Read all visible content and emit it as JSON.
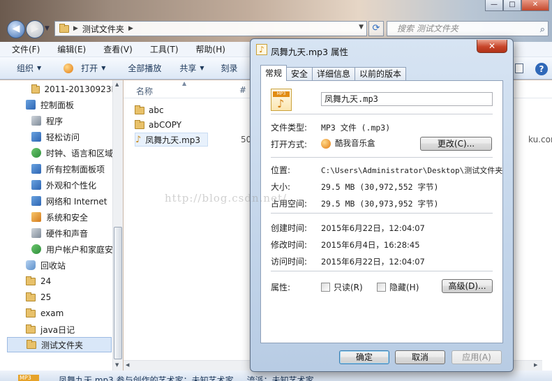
{
  "explorer": {
    "window_controls": {
      "minimize": "—",
      "maximize": "□",
      "close": "✕"
    },
    "address": {
      "crumbs": [
        "测试文件夹"
      ]
    },
    "search": {
      "placeholder": "搜索 测试文件夹"
    },
    "menu": [
      "文件(F)",
      "编辑(E)",
      "查看(V)",
      "工具(T)",
      "帮助(H)"
    ],
    "toolbar": [
      "组织",
      "打开",
      "全部播放",
      "共享",
      "刻录"
    ],
    "nav": [
      {
        "label": "2011-20130923I",
        "icon": "folder-icon"
      },
      {
        "label": "控制面板",
        "icon": "control-panel-icon"
      },
      {
        "label": "程序",
        "icon": "programs-icon"
      },
      {
        "label": "轻松访问",
        "icon": "ease-of-access-icon"
      },
      {
        "label": "时钟、语言和区域",
        "icon": "clock-language-icon"
      },
      {
        "label": "所有控制面板项",
        "icon": "all-items-icon"
      },
      {
        "label": "外观和个性化",
        "icon": "appearance-icon"
      },
      {
        "label": "网络和 Internet",
        "icon": "network-icon"
      },
      {
        "label": "系统和安全",
        "icon": "security-icon"
      },
      {
        "label": "硬件和声音",
        "icon": "hardware-sound-icon"
      },
      {
        "label": "用户帐户和家庭安全",
        "icon": "user-accounts-icon"
      },
      {
        "label": "回收站",
        "icon": "recycle-bin-icon"
      },
      {
        "label": "24",
        "icon": "folder-icon"
      },
      {
        "label": "25",
        "icon": "folder-icon"
      },
      {
        "label": "exam",
        "icon": "folder-icon"
      },
      {
        "label": "java日记",
        "icon": "folder-icon"
      },
      {
        "label": "测试文件夹",
        "icon": "folder-icon"
      }
    ],
    "columns": {
      "name": "名称",
      "next": "#"
    },
    "files": [
      {
        "name": "abc",
        "icon": "folder-icon"
      },
      {
        "name": "abCOPY",
        "icon": "folder-icon"
      },
      {
        "name": "凤舞九天.mp3",
        "icon": "music-file-icon"
      }
    ],
    "file_size_partial": "50",
    "bg_text_right": "ku.com",
    "status": {
      "filename": "凤舞九天.mp3",
      "text": "凤舞九天.mp3  参与创作的艺术家：未知艺术家  ...   流派：未知艺术家"
    },
    "watermark": "http://blog.csdn.net/"
  },
  "dialog": {
    "title": "凤舞九天.mp3 属性",
    "close": "✕",
    "tabs": [
      "常规",
      "安全",
      "详细信息",
      "以前的版本"
    ],
    "active_tab": "常规",
    "file_name": "凤舞九天.mp3",
    "rows": [
      {
        "label": "文件类型:",
        "value": "MP3 文件 (.mp3)"
      },
      {
        "label": "打开方式:",
        "value": "酷我音乐盒"
      },
      {
        "label": "位置:",
        "value": "C:\\Users\\Administrator\\Desktop\\测试文件夹"
      },
      {
        "label": "大小:",
        "value": "29.5 MB (30,972,552 字节)"
      },
      {
        "label": "占用空间:",
        "value": "29.5 MB (30,973,952 字节)"
      },
      {
        "label": "创建时间:",
        "value": "2015年6月22日，12:04:07"
      },
      {
        "label": "修改时间:",
        "value": "2015年6月4日，16:28:45"
      },
      {
        "label": "访问时间:",
        "value": "2015年6月22日，12:04:07"
      }
    ],
    "change_button": "更改(C)...",
    "attributes_label": "属性:",
    "readonly": "只读(R)",
    "hidden": "隐藏(H)",
    "advanced_button": "高级(D)...",
    "ok": "确定",
    "cancel": "取消",
    "apply": "应用(A)"
  }
}
